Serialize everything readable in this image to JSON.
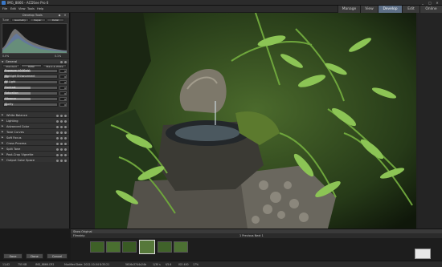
{
  "window": {
    "title": "IMG_8866 - ACDSee Pro 6"
  },
  "menu": [
    "File",
    "Edit",
    "View",
    "Tools",
    "Help"
  ],
  "modes": [
    {
      "label": "Manage",
      "active": false
    },
    {
      "label": "View",
      "active": false
    },
    {
      "label": "Develop",
      "active": true
    },
    {
      "label": "Edit",
      "active": false
    },
    {
      "label": "Online",
      "active": false
    }
  ],
  "panel": {
    "header": "Develop Tools",
    "tone_label": "Tune",
    "tone_buttons": [
      "Geometry",
      "Repair",
      "Detail"
    ],
    "histogram_left": "0.0%",
    "histogram_right": "0.1%",
    "general_label": "General",
    "general_tabs": [
      "Standard",
      "Color",
      "Black & White"
    ],
    "sliders": [
      {
        "label": "Exposure +0.00 eV",
        "value": "0",
        "fill": 0.5
      },
      {
        "label": "Highlight Enhancement",
        "value": "0",
        "fill": 0.08
      },
      {
        "label": "Fill Light",
        "value": "0",
        "fill": 0.06
      },
      {
        "label": "Contrast",
        "value": "0",
        "fill": 0.5
      },
      {
        "label": "Saturation",
        "value": "0",
        "fill": 0.5
      },
      {
        "label": "Vibrance",
        "value": "0",
        "fill": 0.5
      },
      {
        "label": "Clarity",
        "value": "0",
        "fill": 0.06
      }
    ],
    "sections": [
      "White Balance",
      "Lighting",
      "Advanced Color",
      "Tone Curves",
      "Soft Focus",
      "Cross Process",
      "Split Tone",
      "Post-Crop Vignette",
      "Output Color Space"
    ],
    "buttons": [
      "Save",
      "Done",
      "Cancel"
    ]
  },
  "filmstrip": {
    "header": "Show Original",
    "bar_left": "Filmstrip",
    "bar_center": "1 Previous  Next 1"
  },
  "status": {
    "items": [
      "11/42",
      "755 KB",
      "IMG_8866.CR2",
      "Modified Date: 2012-10-04 8:35:21",
      "5616x3744x24b",
      "1/30 s",
      "f/5.6",
      "ISO 400",
      "17%"
    ],
    "zoom": "17%"
  },
  "colors": {
    "accent": "#5d6f86",
    "panel_bg": "#2e2e2e",
    "app_bg": "#1a1a1a"
  }
}
